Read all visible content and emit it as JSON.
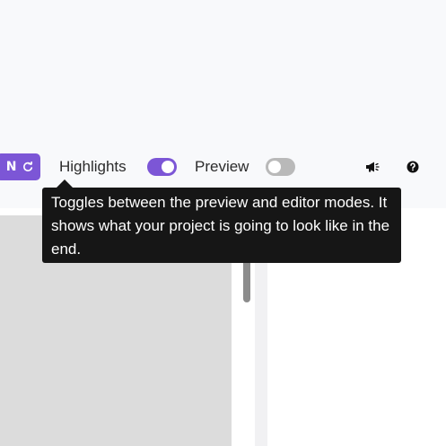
{
  "toolbar": {
    "run_label": "N",
    "highlights_label": "Highlights",
    "highlights_enabled": true,
    "preview_label": "Preview",
    "preview_enabled": false,
    "icons": {
      "refresh": "refresh-icon",
      "announcement": "megaphone-icon",
      "help": "question-circle-icon"
    }
  },
  "tooltip": {
    "text": "Toggles between the preview and editor modes. It shows what your project is going to look like in the end."
  },
  "colors": {
    "accent": "#7c56d6",
    "toggle_off": "#b9b9b9",
    "tooltip_bg": "#161616",
    "top_bg": "#f8f9fb",
    "panel_bg": "#dcdcdc"
  }
}
